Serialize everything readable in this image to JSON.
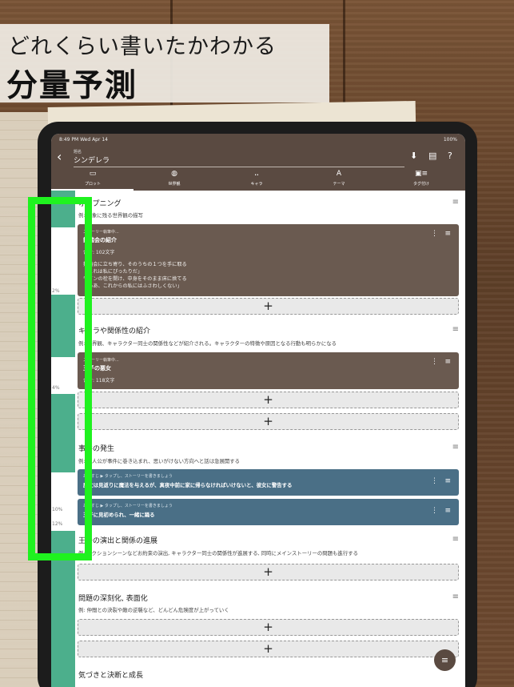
{
  "promo": {
    "subtitle": "どれくらい書いたかわかる",
    "title": "分量予測"
  },
  "status_bar": {
    "time": "8:49 PM  Wed Apr 14",
    "battery": "100%"
  },
  "header": {
    "back_icon": "chevron-left-icon",
    "title_caption": "題名",
    "title_value": "シンデレラ",
    "actions": [
      "download-icon",
      "library-icon",
      "help-icon"
    ]
  },
  "tabs": [
    {
      "label": "プロット",
      "icon": "chat-icon",
      "selected": true
    },
    {
      "label": "世界観",
      "icon": "globe-icon"
    },
    {
      "label": "キャラ",
      "icon": "people-icon"
    },
    {
      "label": "テーマ",
      "icon": "text-icon"
    },
    {
      "label": "タグ付け",
      "icon": "tag-icon"
    }
  ],
  "progress_rail": {
    "color": "#4caf8c",
    "percents": [
      "2%",
      "4%",
      "10%",
      "12%"
    ]
  },
  "sections": [
    {
      "title": "オープニング",
      "desc": "例: 印象に残る世界観の描写",
      "card": {
        "head": "ストーリー執筆中...",
        "title": "舞踏会の紹介",
        "count": "合計: 102文字",
        "body": "舞踏会に立ち寄り、そのうちの１つを手に取る\n「これは私にぴったりだ」\nワインの栓を開け、中身をそのまま床に捨てる\n「ああ、これからの私にはふさわしくない」"
      }
    },
    {
      "title": "キャラや関係性の紹介",
      "desc": "例: 世界観、キャラクター同士の関係性などが紹介される。キャラクターの特徴や原因となる行動も明らかになる",
      "card": {
        "head": "ストーリー執筆中...",
        "title": "王子の悪女",
        "count": "合計: 118文字"
      }
    },
    {
      "title": "事件の発生",
      "desc": "例: 主人公が事件に巻き込まれ、思いがけない方向へと話は急展開する",
      "cards": [
        {
          "head": "あらすじ ▶ タップし、ストーリーを書きましょう",
          "text": "魔女は見返りに魔法を与えるが、真夜中前に家に帰らなければいけないと、彼女に警告する"
        },
        {
          "head": "あらすじ ▶ タップし、ストーリーを書きましょう",
          "text": "王子に見初められ、一緒に踊る"
        }
      ]
    },
    {
      "title": "王子の演出と関係の進展",
      "desc": "例: アクションシーンなどお約束の演出, キャラクター同士の関係性が進展する, 同時にメインストーリーの問題も進行する"
    },
    {
      "title": "問題の深刻化, 表面化",
      "desc": "例: 仲間との決裂や敵の逆襲など、どんどん危険度が上がっていく"
    },
    {
      "title": "気づきと決断と成長"
    }
  ],
  "add_label": "+",
  "card_menu_label": "⋮",
  "hamburger_label": "≡",
  "fab_label": "≡"
}
